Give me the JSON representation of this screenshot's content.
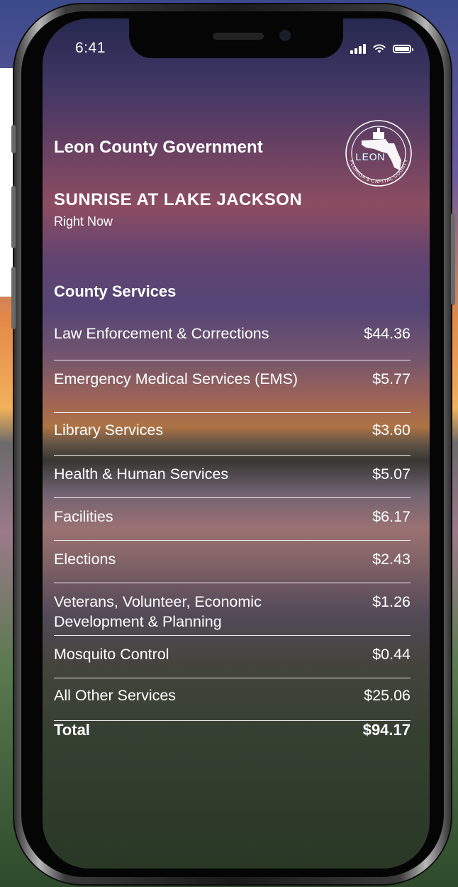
{
  "status_bar": {
    "time": "6:41",
    "icons": [
      "cellular-signal-icon",
      "wifi-icon",
      "battery-icon"
    ]
  },
  "header": {
    "organization": "Leon County Government",
    "logo": {
      "text": "LEON",
      "ring_text": "FLORIDA'S CAPITAL COUNTY"
    }
  },
  "photo_caption": {
    "title": "SUNRISE AT LAKE JACKSON",
    "subtitle": "Right Now"
  },
  "county_services": {
    "heading": "County Services",
    "rows": [
      {
        "name": "Law Enforcement & Corrections",
        "amount": "$44.36"
      },
      {
        "name": "Emergency Medical Services (EMS)",
        "amount": "$5.77"
      },
      {
        "name": "Library Services",
        "amount": "$3.60"
      },
      {
        "name": "Health & Human Services",
        "amount": "$5.07"
      },
      {
        "name": "Facilities",
        "amount": "$6.17"
      },
      {
        "name": "Elections",
        "amount": "$2.43"
      },
      {
        "name": "Veterans, Volunteer, Economic Development & Planning",
        "amount": "$1.26"
      },
      {
        "name": "Mosquito Control",
        "amount": "$0.44"
      },
      {
        "name": "All Other Services",
        "amount": "$25.06"
      }
    ],
    "total": {
      "label": "Total",
      "amount": "$94.17"
    }
  },
  "colors": {
    "text": "#ffffff",
    "divider": "#ffffff",
    "phone_frame": "#1a1a1a"
  }
}
